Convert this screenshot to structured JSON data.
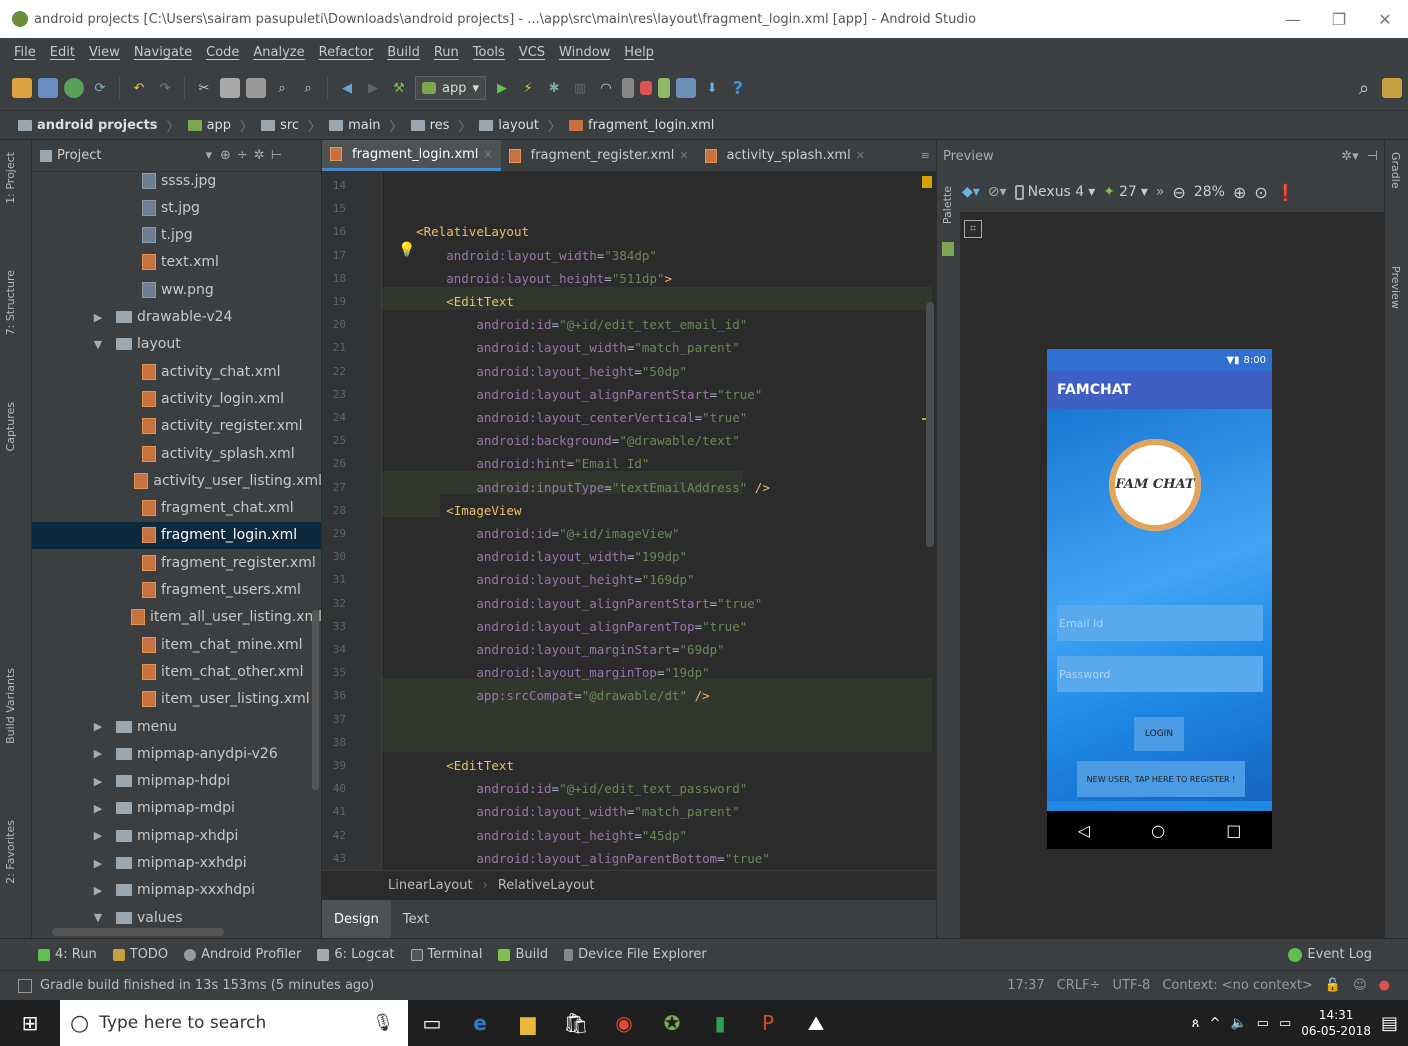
{
  "window": {
    "title": "android projects [C:\\Users\\sairam pasupuleti\\Downloads\\android projects] - ...\\app\\src\\main\\res\\layout\\fragment_login.xml [app] - Android Studio",
    "min": "—",
    "max": "❐",
    "close": "✕"
  },
  "menu": [
    "File",
    "Edit",
    "View",
    "Navigate",
    "Code",
    "Analyze",
    "Refactor",
    "Build",
    "Run",
    "Tools",
    "VCS",
    "Window",
    "Help"
  ],
  "toolbar": {
    "config": "app"
  },
  "breadcrumb": [
    "android projects",
    "app",
    "src",
    "main",
    "res",
    "layout",
    "fragment_login.xml"
  ],
  "leftstrip": [
    "1: Project",
    "7: Structure",
    "Captures",
    "Build Variants",
    "2: Favorites"
  ],
  "project": {
    "header": "Project",
    "rows": [
      {
        "label": "ssss.jpg",
        "type": "img",
        "indent": 2
      },
      {
        "label": "st.jpg",
        "type": "img",
        "indent": 2
      },
      {
        "label": "t.jpg",
        "type": "img",
        "indent": 2
      },
      {
        "label": "text.xml",
        "type": "xml",
        "indent": 2
      },
      {
        "label": "ww.png",
        "type": "img",
        "indent": 2
      },
      {
        "label": "drawable-v24",
        "type": "folder",
        "indent": 1,
        "arrow": "▶"
      },
      {
        "label": "layout",
        "type": "folder",
        "indent": 1,
        "arrow": "▼"
      },
      {
        "label": "activity_chat.xml",
        "type": "xml",
        "indent": 2
      },
      {
        "label": "activity_login.xml",
        "type": "xml",
        "indent": 2
      },
      {
        "label": "activity_register.xml",
        "type": "xml",
        "indent": 2
      },
      {
        "label": "activity_splash.xml",
        "type": "xml",
        "indent": 2
      },
      {
        "label": "activity_user_listing.xml",
        "type": "xml",
        "indent": 2
      },
      {
        "label": "fragment_chat.xml",
        "type": "xml",
        "indent": 2
      },
      {
        "label": "fragment_login.xml",
        "type": "xml",
        "indent": 2,
        "selected": true
      },
      {
        "label": "fragment_register.xml",
        "type": "xml",
        "indent": 2
      },
      {
        "label": "fragment_users.xml",
        "type": "xml",
        "indent": 2
      },
      {
        "label": "item_all_user_listing.xml",
        "type": "xml",
        "indent": 2
      },
      {
        "label": "item_chat_mine.xml",
        "type": "xml",
        "indent": 2
      },
      {
        "label": "item_chat_other.xml",
        "type": "xml",
        "indent": 2
      },
      {
        "label": "item_user_listing.xml",
        "type": "xml",
        "indent": 2
      },
      {
        "label": "menu",
        "type": "folder",
        "indent": 1,
        "arrow": "▶"
      },
      {
        "label": "mipmap-anydpi-v26",
        "type": "folder",
        "indent": 1,
        "arrow": "▶"
      },
      {
        "label": "mipmap-hdpi",
        "type": "folder",
        "indent": 1,
        "arrow": "▶"
      },
      {
        "label": "mipmap-mdpi",
        "type": "folder",
        "indent": 1,
        "arrow": "▶"
      },
      {
        "label": "mipmap-xhdpi",
        "type": "folder",
        "indent": 1,
        "arrow": "▶"
      },
      {
        "label": "mipmap-xxhdpi",
        "type": "folder",
        "indent": 1,
        "arrow": "▶"
      },
      {
        "label": "mipmap-xxxhdpi",
        "type": "folder",
        "indent": 1,
        "arrow": "▶"
      },
      {
        "label": "values",
        "type": "folder",
        "indent": 1,
        "arrow": "▼"
      }
    ]
  },
  "editor": {
    "tabs": [
      {
        "label": "fragment_login.xml",
        "active": true
      },
      {
        "label": "fragment_register.xml",
        "active": false
      },
      {
        "label": "activity_splash.xml",
        "active": false
      }
    ],
    "lines": [
      {
        "n": "14",
        "html": ""
      },
      {
        "n": "15",
        "html": ""
      },
      {
        "n": "16",
        "html": "    <span class='tag'>&lt;RelativeLayout</span>"
      },
      {
        "n": "17",
        "html": "        <span class='ns'>android:</span><span class='attr'>layout_width</span>=<span class='val'>\"384dp\"</span>"
      },
      {
        "n": "18",
        "html": "        <span class='ns'>android:</span><span class='attr'>layout_height</span>=<span class='val'>\"511dp\"</span><span class='tag'>&gt;</span>"
      },
      {
        "n": "19",
        "html": "        <span class='tag'>&lt;EditText</span>"
      },
      {
        "n": "20",
        "html": "            <span class='ns'>android:</span><span class='attr'>id</span>=<span class='val'>\"@+id/edit_text_email_id\"</span>"
      },
      {
        "n": "21",
        "html": "            <span class='ns'>android:</span><span class='attr'>layout_width</span>=<span class='val'>\"match_parent\"</span>"
      },
      {
        "n": "22",
        "html": "            <span class='ns'>android:</span><span class='attr'>layout_height</span>=<span class='val'>\"50dp\"</span>"
      },
      {
        "n": "23",
        "html": "            <span class='ns'>android:</span><span class='attr'>layout_alignParentStart</span>=<span class='val'>\"true\"</span>"
      },
      {
        "n": "24",
        "html": "            <span class='ns'>android:</span><span class='attr'>layout_centerVertical</span>=<span class='val'>\"true\"</span>"
      },
      {
        "n": "25",
        "html": "            <span class='ns'>android:</span><span class='attr'>background</span>=<span class='val'>\"@drawable/text\"</span>"
      },
      {
        "n": "26",
        "html": "            <span class='ns'>android:</span><span class='attr'>hint</span>=<span class='val'>\"Email Id\"</span>"
      },
      {
        "n": "27",
        "html": "            <span class='ns'>android:</span><span class='attr'>inputType</span>=<span class='val'>\"textEmailAddress\"</span> <span class='tag'>/&gt;</span>"
      },
      {
        "n": "28",
        "html": "        <span class='tag'>&lt;ImageView</span>"
      },
      {
        "n": "29",
        "html": "            <span class='ns'>android:</span><span class='attr'>id</span>=<span class='val'>\"@+id/imageView\"</span>"
      },
      {
        "n": "30",
        "html": "            <span class='ns'>android:</span><span class='attr'>layout_width</span>=<span class='val'>\"199dp\"</span>"
      },
      {
        "n": "31",
        "html": "            <span class='ns'>android:</span><span class='attr'>layout_height</span>=<span class='val'>\"169dp\"</span>"
      },
      {
        "n": "32",
        "html": "            <span class='ns'>android:</span><span class='attr'>layout_alignParentStart</span>=<span class='val'>\"true\"</span>"
      },
      {
        "n": "33",
        "html": "            <span class='ns'>android:</span><span class='attr'>layout_alignParentTop</span>=<span class='val'>\"true\"</span>"
      },
      {
        "n": "34",
        "html": "            <span class='ns'>android:</span><span class='attr'>layout_marginStart</span>=<span class='val'>\"69dp\"</span>"
      },
      {
        "n": "35",
        "html": "            <span class='ns'>android:</span><span class='attr'>layout_marginTop</span>=<span class='val'>\"19dp\"</span>"
      },
      {
        "n": "36",
        "html": "            <span class='ns'>app:</span><span class='attr'>srcCompat</span>=<span class='val'>\"@drawable/dt\"</span> <span class='tag'>/&gt;</span>"
      },
      {
        "n": "37",
        "html": ""
      },
      {
        "n": "38",
        "html": ""
      },
      {
        "n": "39",
        "html": "        <span class='tag'>&lt;EditText</span>"
      },
      {
        "n": "40",
        "html": "            <span class='ns'>android:</span><span class='attr'>id</span>=<span class='val'>\"@+id/edit_text_password\"</span>"
      },
      {
        "n": "41",
        "html": "            <span class='ns'>android:</span><span class='attr'>layout_width</span>=<span class='val'>\"match_parent\"</span>"
      },
      {
        "n": "42",
        "html": "            <span class='ns'>android:</span><span class='attr'>layout_height</span>=<span class='val'>\"45dp\"</span>"
      },
      {
        "n": "43",
        "html": "            <span class='ns'>android:</span><span class='attr'>layout_alignParentBottom</span>=<span class='val'>\"true\"</span>"
      }
    ],
    "code_breadcrumb": [
      "LinearLayout",
      "RelativeLayout"
    ],
    "design_tabs": [
      "Design",
      "Text"
    ]
  },
  "preview": {
    "title": "Preview",
    "palette": "Palette",
    "device": "Nexus 4",
    "api": "27",
    "zoom": "28%",
    "phone": {
      "time": "8:00",
      "appbar": "FAMCHAT",
      "logo": "FAM CHAT",
      "email_hint": "Email Id",
      "password_hint": "Password",
      "login": "LOGIN",
      "register": "NEW USER, TAP HERE TO REGISTER !"
    }
  },
  "rightstrip": [
    "Gradle",
    "Preview"
  ],
  "toolwindows": [
    "4: Run",
    "TODO",
    "Android Profiler",
    "6: Logcat",
    "Terminal",
    "Build",
    "Device File Explorer"
  ],
  "event_log": "Event Log",
  "status": {
    "message": "Gradle build finished in 13s 153ms (5 minutes ago)",
    "position": "17:37",
    "line_sep": "CRLF÷",
    "encoding": "UTF-8",
    "context": "Context: <no context>"
  },
  "taskbar": {
    "search_placeholder": "Type here to search",
    "time": "14:31",
    "date": "06-05-2018"
  }
}
